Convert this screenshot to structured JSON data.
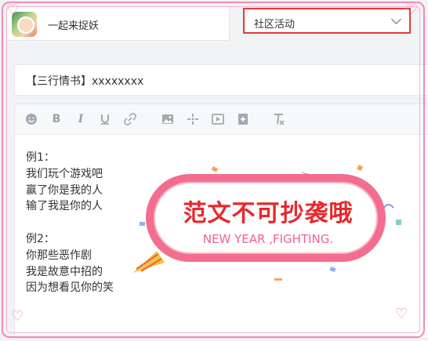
{
  "game": {
    "name": "一起来捉妖"
  },
  "category": {
    "selected": "社区活动"
  },
  "post": {
    "title": "【三行情书】xxxxxxxx"
  },
  "toolbar": {
    "items": [
      "emoji-icon",
      "bold-icon",
      "italic-icon",
      "underline-icon",
      "link-icon",
      "image-icon",
      "move-icon",
      "video-icon",
      "add-icon",
      "clear-format-icon"
    ]
  },
  "content": {
    "lines": [
      "例1：",
      "我们玩个游戏吧",
      "赢了你是我的人",
      "输了我是你的人",
      "",
      "例2：",
      "你那些恶作剧",
      "我是故意中招的",
      "因为想看见你的笑"
    ]
  },
  "banner": {
    "title": "范文不可抄袭哦",
    "subtitle": "NEW YEAR ,FIGHTING."
  },
  "colors": {
    "frame": "#f08bb4",
    "highlight": "#e53a3a",
    "banner_border": "#f26d8e",
    "banner_title": "#e8282d",
    "banner_sub": "#f06292"
  }
}
